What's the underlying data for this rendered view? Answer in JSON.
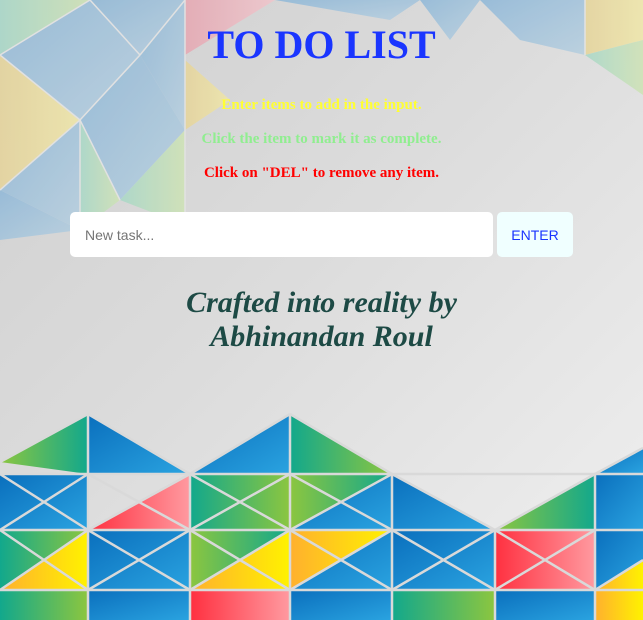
{
  "page": {
    "title": "TO DO LIST",
    "instructions": {
      "add": "Enter items to add in the input.",
      "complete": "Click the item to mark it as complete.",
      "remove": "Click on \"DEL\" to remove any item."
    },
    "input": {
      "placeholder": "New task...",
      "value": ""
    },
    "enter_button_label": "ENTER",
    "credit": {
      "line1": "Crafted into reality by",
      "line2": "Abhinandan Roul"
    }
  },
  "colors": {
    "title": "#1a35ff",
    "instr_add": "#ffff33",
    "instr_complete": "#90ee90",
    "instr_remove": "#ff0000",
    "enter_button_bg": "#f0ffff",
    "enter_button_text": "#1a35ff",
    "credit": "#1d4a45"
  }
}
